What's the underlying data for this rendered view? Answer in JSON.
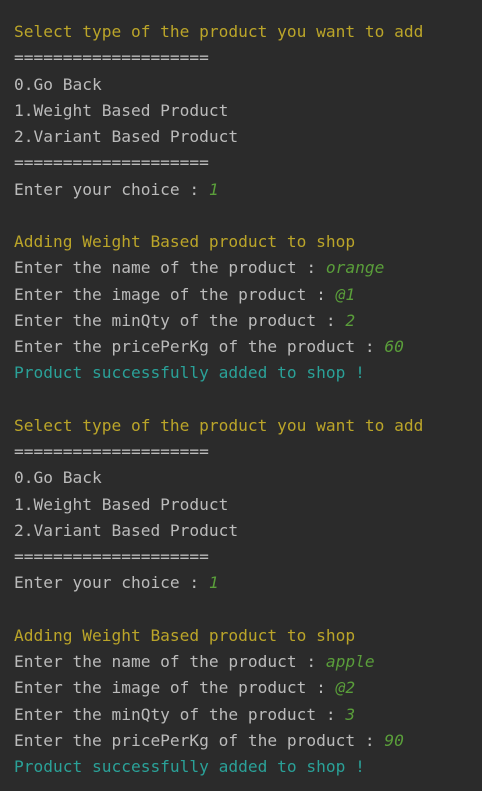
{
  "blocks": [
    {
      "menu_title": "Select type of the product you want to add",
      "separator_top": "====================",
      "options": [
        "0.Go Back",
        "1.Weight Based Product",
        "2.Variant Based Product"
      ],
      "separator_bottom": "====================",
      "choice_prompt": "Enter your choice : ",
      "choice_value": "1",
      "section_title": "Adding Weight Based product to shop",
      "name_prompt": "Enter the name of the product : ",
      "name_value": "orange",
      "image_prompt": "Enter the image of the product : ",
      "image_value": "@1",
      "minqty_prompt": "Enter the minQty of the product : ",
      "minqty_value": "2",
      "price_prompt": "Enter the pricePerKg of the product : ",
      "price_value": "60",
      "success_message": "Product successfully added to shop !"
    },
    {
      "menu_title": "Select type of the product you want to add",
      "separator_top": "====================",
      "options": [
        "0.Go Back",
        "1.Weight Based Product",
        "2.Variant Based Product"
      ],
      "separator_bottom": "====================",
      "choice_prompt": "Enter your choice : ",
      "choice_value": "1",
      "section_title": "Adding Weight Based product to shop",
      "name_prompt": "Enter the name of the product : ",
      "name_value": "apple",
      "image_prompt": "Enter the image of the product : ",
      "image_value": "@2",
      "minqty_prompt": "Enter the minQty of the product : ",
      "minqty_value": "3",
      "price_prompt": "Enter the pricePerKg of the product : ",
      "price_value": "90",
      "success_message": "Product successfully added to shop !"
    }
  ],
  "colors": {
    "background": "#2b2b2b",
    "heading": "#bba529",
    "plain_text": "#bbbbbb",
    "user_input": "#5a9e3a",
    "success": "#2aa198"
  }
}
